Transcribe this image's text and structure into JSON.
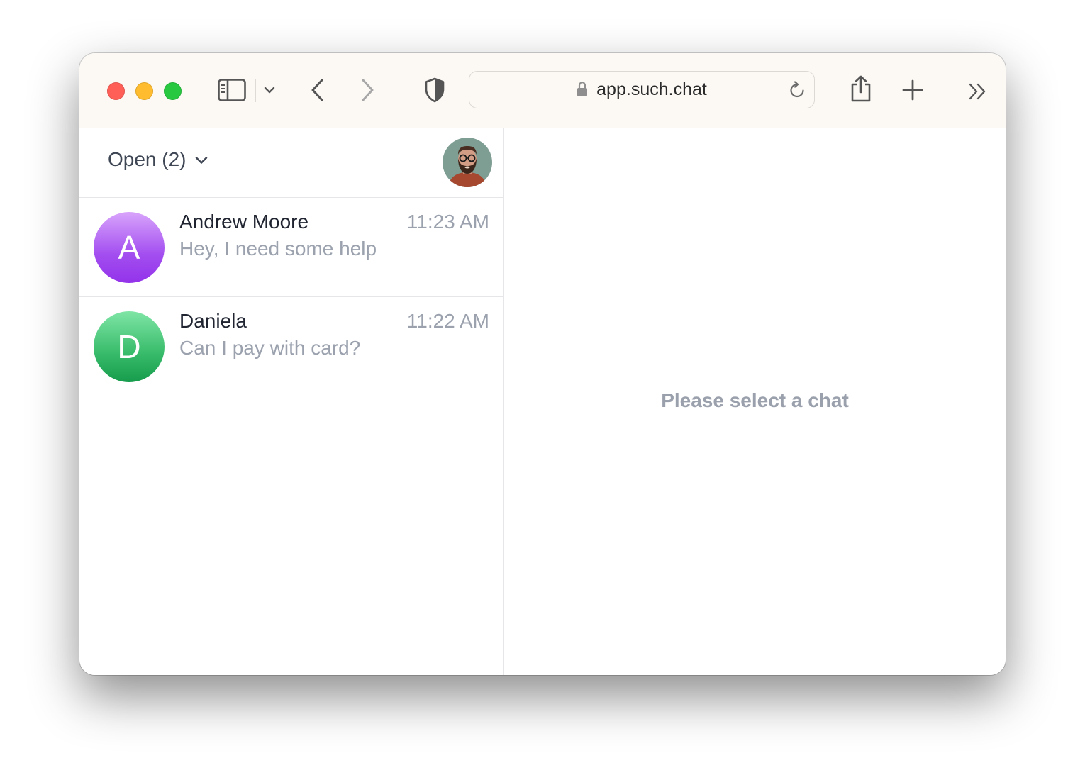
{
  "browser": {
    "url": "app.such.chat",
    "icons": [
      "sidebar-toggle-icon",
      "chevron-down-icon",
      "back-icon",
      "forward-icon",
      "shield-icon",
      "lock-icon",
      "reload-icon",
      "share-icon",
      "plus-icon",
      "double-chevron-right-icon"
    ]
  },
  "sidebar": {
    "filter_label": "Open (2)",
    "conversations": [
      {
        "initial": "A",
        "name": "Andrew Moore",
        "preview": "Hey, I need some help",
        "time": "11:23 AM",
        "avatar_color": "#a855f7"
      },
      {
        "initial": "D",
        "name": "Daniela",
        "preview": "Can I pay with card?",
        "time": "11:22 AM",
        "avatar_color": "#22c55e"
      }
    ]
  },
  "main": {
    "empty_message": "Please select a chat"
  },
  "colors": {
    "toolbar_bg": "#fcf9f5",
    "text_primary": "#1f2430",
    "text_muted": "#9ba2ae"
  }
}
